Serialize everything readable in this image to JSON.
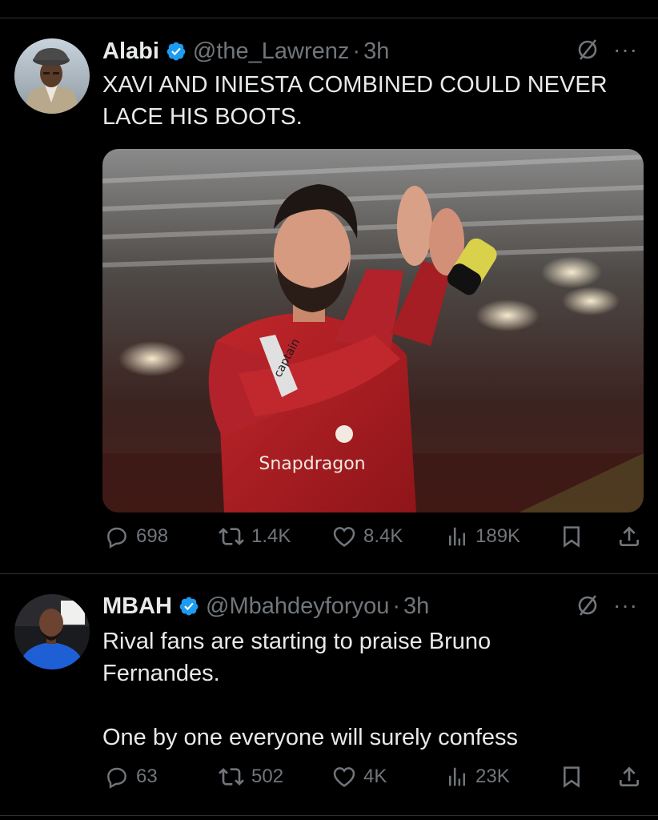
{
  "tweets": [
    {
      "name": "Alabi",
      "handle": "@the_Lawrenz",
      "sep": "·",
      "time": "3h",
      "text": "XAVI AND INIESTA COMBINED COULD NEVER LACE HIS BOOTS.",
      "more": "···",
      "media": {
        "kit_sponsor": "Snapdragon",
        "armband": "captain"
      },
      "stats": {
        "replies": "698",
        "reposts": "1.4K",
        "likes": "8.4K",
        "views": "189K"
      }
    },
    {
      "name": "MBAH",
      "handle": "@Mbahdeyforyou",
      "sep": "·",
      "time": "3h",
      "text": "Rival fans are starting to praise Bruno Fernandes.\n\nOne by one everyone will surely confess",
      "more": "···",
      "stats": {
        "replies": "63",
        "reposts": "502",
        "likes": "4K",
        "views": "23K"
      }
    }
  ],
  "icons": [
    "verified-badge-icon",
    "grok-icon",
    "more-icon",
    "reply-icon",
    "repost-icon",
    "like-icon",
    "views-icon",
    "bookmark-icon",
    "share-icon"
  ],
  "colors": {
    "background": "#000000",
    "text": "#e7e9ea",
    "muted": "#71767b",
    "verified": "#1d9bf0",
    "divider": "#2f3336"
  }
}
